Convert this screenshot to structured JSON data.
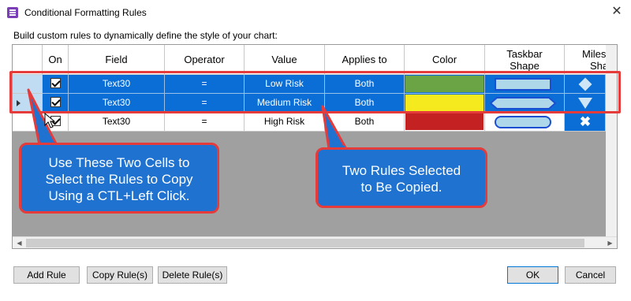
{
  "window": {
    "title": "Conditional Formatting Rules",
    "close_glyph": "✕"
  },
  "subtitle": "Build custom rules to dynamically define the style of your chart:",
  "columns": [
    {
      "label": "On"
    },
    {
      "label": "Field"
    },
    {
      "label": "Operator"
    },
    {
      "label": "Value"
    },
    {
      "label": "Applies to"
    },
    {
      "label": "Color"
    },
    {
      "label_line1": "Taskbar",
      "label_line2": "Shape"
    },
    {
      "label_line1": "Milestone",
      "label_line2": "Shape"
    }
  ],
  "rows": [
    {
      "on": true,
      "field": "Text30",
      "operator": "=",
      "value": "Low Risk",
      "applies_to": "Both",
      "color": "#6aa444",
      "taskbar_shape": "rectangle",
      "milestone_shape": "diamond",
      "selected": true
    },
    {
      "on": true,
      "field": "Text30",
      "operator": "=",
      "value": "Medium Risk",
      "applies_to": "Both",
      "color": "#f4ea1e",
      "taskbar_shape": "hexagon",
      "milestone_shape": "triangle-down",
      "selected": true
    },
    {
      "on": true,
      "field": "Text30",
      "operator": "=",
      "value": "High Risk",
      "applies_to": "Both",
      "color": "#c42222",
      "taskbar_shape": "rounded",
      "milestone_shape": "x",
      "selected": false
    }
  ],
  "callouts": {
    "left": {
      "line1": "Use These Two Cells to",
      "line2": "Select the Rules to Copy",
      "line3": "Using a CTL+Left Click."
    },
    "right": {
      "line1": "Two Rules Selected",
      "line2": "to Be Copied."
    }
  },
  "buttons": {
    "add_rule": "Add Rule",
    "copy_rules": "Copy Rule(s)",
    "delete_rules": "Delete Rule(s)",
    "ok": "OK",
    "cancel": "Cancel"
  },
  "colors": {
    "selection": "#0a6ed6",
    "highlight_border": "#e53b3b",
    "callout_fill": "#1f72cf",
    "shape_fill": "#aed8ea",
    "shape_border": "#1b4fd1"
  },
  "icons": {
    "app": "rules-app-icon",
    "close": "close-icon",
    "row_indicator": "row-pointer-icon",
    "cursor": "mouse-cursor-icon"
  }
}
